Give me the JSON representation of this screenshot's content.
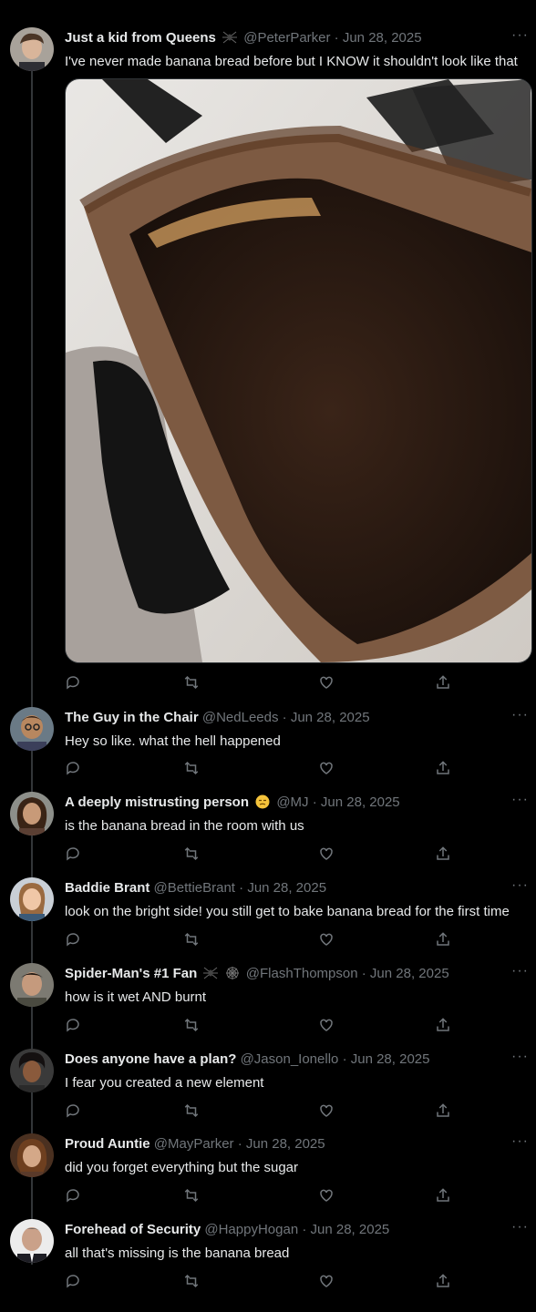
{
  "tweets": [
    {
      "name": "Just a kid from Queens",
      "name_emoji": "spider-icon",
      "handle": "@PeterParker",
      "date": "Jun 28, 2025",
      "text": "I've never made banana bread before but I KNOW it shouldn't look like that",
      "media": "burnt-banana-bread-photo"
    },
    {
      "name": "The Guy in the Chair",
      "handle": "@NedLeeds",
      "date": "Jun 28, 2025",
      "text": "Hey so like. what the hell happened"
    },
    {
      "name": "A deeply mistrusting person",
      "name_emoji": "unamused-face-icon",
      "handle": "@MJ",
      "date": "Jun 28, 2025",
      "text": "is the banana bread in the room with us"
    },
    {
      "name": "Baddie Brant",
      "handle": "@BettieBrant",
      "date": "Jun 28, 2025",
      "text": "look on the bright side! you still get to bake banana bread for the first time"
    },
    {
      "name": "Spider-Man's #1 Fan",
      "name_emoji": "spider-and-web-icon",
      "handle": "@FlashThompson",
      "date": "Jun 28, 2025",
      "text": "how is it wet AND burnt"
    },
    {
      "name": "Does anyone have a plan?",
      "handle": "@Jason_Ionello",
      "date": "Jun 28, 2025",
      "text": "I fear you created a new element"
    },
    {
      "name": "Proud Auntie",
      "handle": "@MayParker",
      "date": "Jun 28, 2025",
      "text": "did you forget everything but the sugar"
    },
    {
      "name": "Forehead of Security",
      "handle": "@HappyHogan",
      "date": "Jun 28, 2025",
      "text": "all that's missing is the banana bread"
    }
  ],
  "separator": "·",
  "more_label": "···",
  "actions": [
    "reply-icon",
    "retweet-icon",
    "like-icon",
    "share-icon"
  ],
  "colors": {
    "background": "#000000",
    "text": "#e7e9ea",
    "secondary": "#71767b",
    "thread_line": "#333639"
  }
}
